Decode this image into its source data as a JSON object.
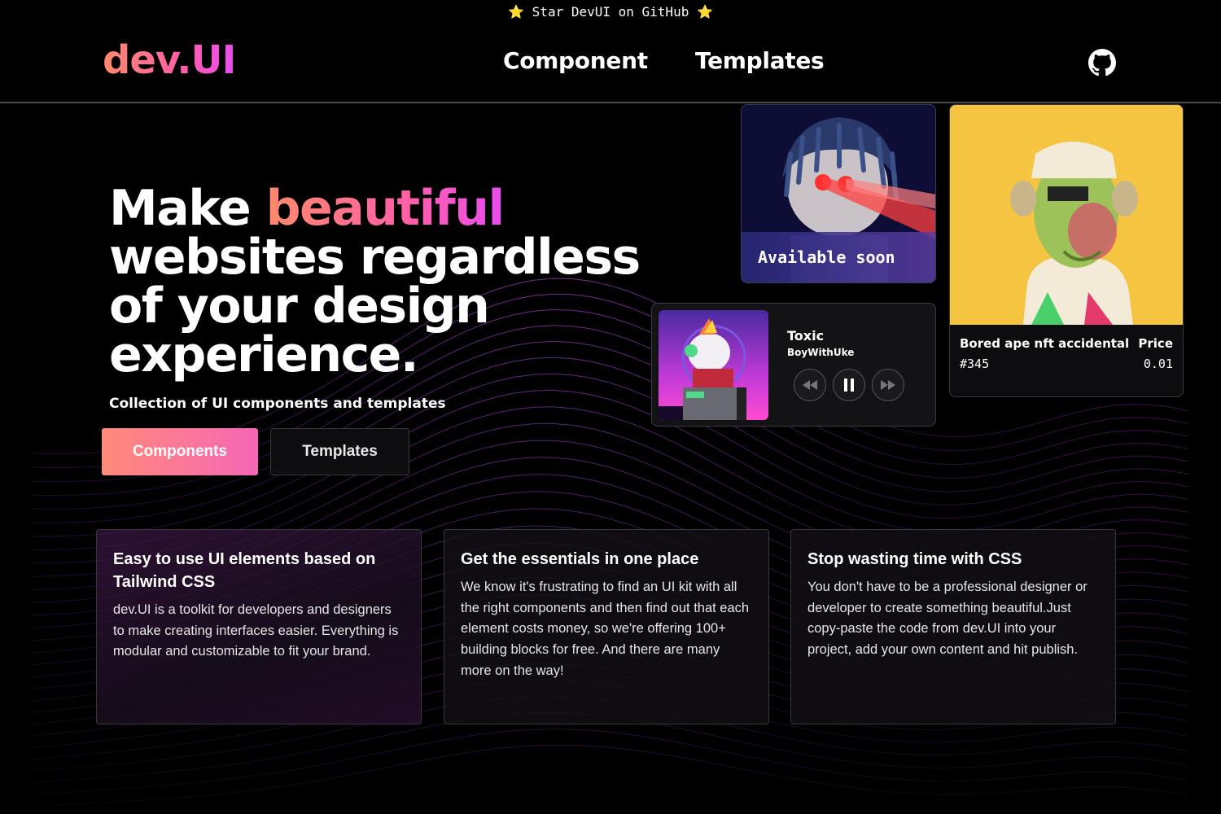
{
  "announcement": {
    "star_left": "⭐",
    "text": "Star DevUI on GitHub",
    "star_right": "⭐"
  },
  "nav": {
    "logo": "dev.UI",
    "links": [
      "Component",
      "Templates"
    ],
    "github_icon": "github-icon"
  },
  "hero": {
    "title_1": "Make ",
    "title_highlight": "beautiful",
    "title_2": "websites regardless of your design experience.",
    "subtitle": "Collection of UI components and templates",
    "primary_button": "Components",
    "secondary_button": "Templates"
  },
  "cards": {
    "available": {
      "label": "Available soon"
    },
    "music": {
      "title": "Toxic",
      "artist": "BoyWithUke",
      "controls": [
        "rewind-icon",
        "pause-icon",
        "fast-forward-icon"
      ]
    },
    "nft": {
      "name": "Bored ape nft accidental",
      "id": "#345",
      "price_label": "Price",
      "price": "0.01"
    }
  },
  "features": [
    {
      "title": "Easy to use UI elements based on Tailwind CSS",
      "body": "dev.UI is a toolkit for developers and designers to make creating interfaces easier. Everything is modular and customizable to fit your brand."
    },
    {
      "title": "Get the essentials in one place",
      "body": "We know it's frustrating to find an UI kit with all the right components and then find out that each element costs money, so we're offering 100+ building blocks for free. And there are many more on the way!"
    },
    {
      "title": "Stop wasting time with CSS",
      "body": "You don't have to be a professional designer or developer to create something beautiful.Just copy-paste the code from dev.UI into your project, add your own content and hit publish."
    }
  ],
  "colors": {
    "accent_start": "#ff8a6b",
    "accent_mid": "#ff5fa8",
    "accent_end": "#e84cf0",
    "nft_bg": "#f5c542",
    "grid": "#7a2a9a"
  }
}
